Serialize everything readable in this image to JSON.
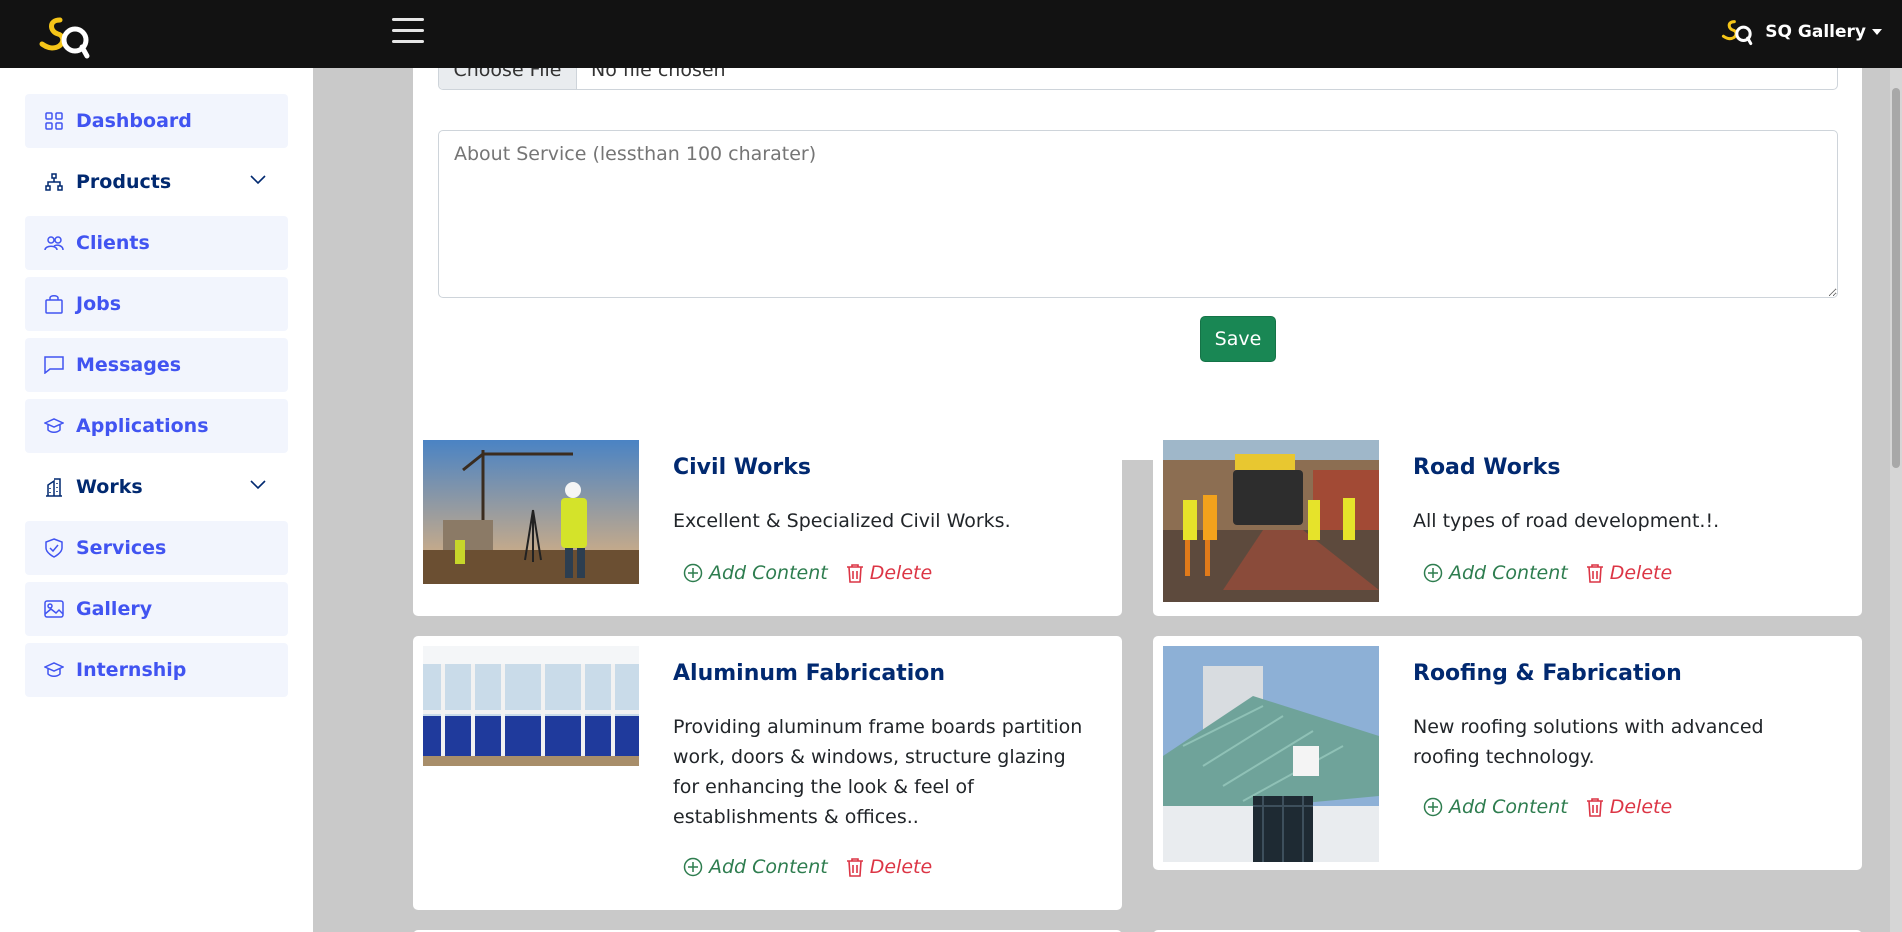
{
  "header": {
    "user_name": "SQ Gallery"
  },
  "sidebar": {
    "items": [
      {
        "label": "Dashboard",
        "icon": "grid-icon"
      },
      {
        "label": "Products",
        "icon": "diagram-icon",
        "expandable": true
      },
      {
        "label": "Clients",
        "icon": "people-icon"
      },
      {
        "label": "Jobs",
        "icon": "bag-icon"
      },
      {
        "label": "Messages",
        "icon": "chat-icon"
      },
      {
        "label": "Applications",
        "icon": "mortarboard-icon"
      },
      {
        "label": "Works",
        "icon": "building-icon",
        "expandable": true
      },
      {
        "label": "Services",
        "icon": "shield-icon"
      },
      {
        "label": "Gallery",
        "icon": "image-icon"
      },
      {
        "label": "Internship",
        "icon": "mortarboard-icon"
      }
    ]
  },
  "form": {
    "file_button": "Choose File",
    "file_status": "No file chosen",
    "about_placeholder": "About Service (lessthan 100 charater)",
    "save_label": "Save"
  },
  "services": [
    {
      "title": "Civil Works",
      "description": "Excellent & Specialized Civil Works.",
      "add_label": "Add Content",
      "delete_label": "Delete"
    },
    {
      "title": "Road Works",
      "description": "All types of road development.!.",
      "add_label": "Add Content",
      "delete_label": "Delete"
    },
    {
      "title": "Aluminum Fabrication",
      "description": "Providing aluminum frame boards partition work, doors & windows, structure glazing for enhancing the look & feel of establishments & offices..",
      "add_label": "Add Content",
      "delete_label": "Delete"
    },
    {
      "title": "Roofing & Fabrication",
      "description": "New roofing solutions with advanced roofing technology.",
      "add_label": "Add Content",
      "delete_label": "Delete"
    }
  ],
  "colors": {
    "accent": "#4154f1",
    "navy": "#012970",
    "success": "#198754",
    "danger": "#dc3545",
    "logo_yellow": "#f5c518"
  }
}
